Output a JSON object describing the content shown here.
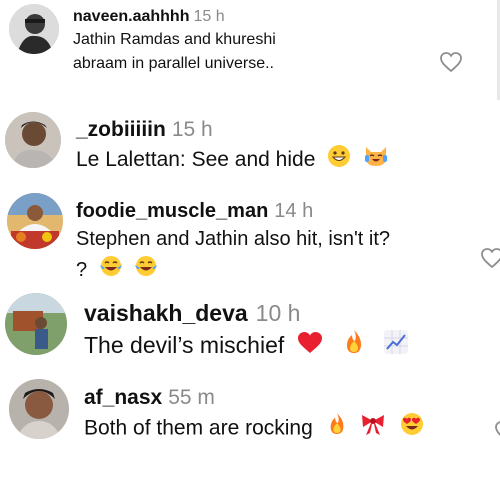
{
  "comments": [
    {
      "username": "naveen.aahhhh",
      "time": "15 h",
      "text_line1": "Jathin Ramdas and khureshi",
      "text_line2": "abraam in parallel universe.."
    },
    {
      "username": "_zobiiiiin",
      "time": "15 h",
      "text_line1": "Le Lalettan: See and hide",
      "emojis": [
        "grinning-face-emoji",
        "joy-cat-emoji"
      ]
    },
    {
      "username": "foodie_muscle_man",
      "time": "14 h",
      "text_line1": "Stephen and Jathin also hit, isn't it?",
      "text_line2": "?",
      "emojis": [
        "tears-of-joy-emoji",
        "tears-of-joy-emoji"
      ]
    },
    {
      "username": "vaishakh_deva",
      "time": "10 h",
      "text_line1": "The devil’s mischief",
      "emojis": [
        "red-heart-emoji",
        "fire-emoji",
        "chart-increasing-emoji"
      ]
    },
    {
      "username": "af_nasx",
      "time": "55 m",
      "text_line1": "Both of them are rocking",
      "emojis": [
        "fire-emoji",
        "ribbon-emoji",
        "heart-eyes-emoji"
      ]
    }
  ],
  "icons": {
    "like": "heart-outline-icon"
  },
  "colors": {
    "username": "#111111",
    "time": "#8a8a8a",
    "text": "#111111",
    "heart_outline": "#8e8e8e"
  }
}
